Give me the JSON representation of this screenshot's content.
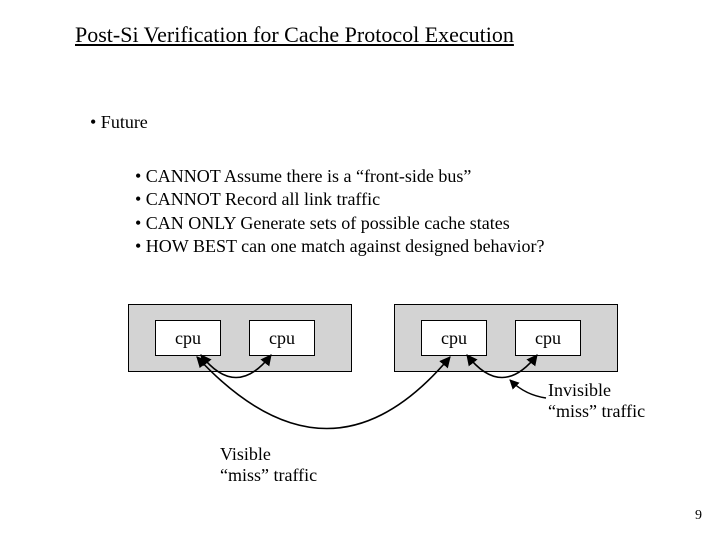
{
  "title": "Post-Si Verification for Cache Protocol Execution",
  "section": "• Future",
  "bullets": {
    "b1": "• CANNOT Assume there is a “front-side bus”",
    "b2": "• CANNOT Record  all link traffic",
    "b3": "• CAN ONLY Generate sets of possible cache states",
    "b4": "•  HOW BEST can one match against designed behavior?"
  },
  "cpu_label": "cpu",
  "annotations": {
    "visible_l1": "Visible",
    "visible_l2": "“miss” traffic",
    "invisible_l1": "Invisible",
    "invisible_l2": "“miss” traffic"
  },
  "page_number": "9"
}
